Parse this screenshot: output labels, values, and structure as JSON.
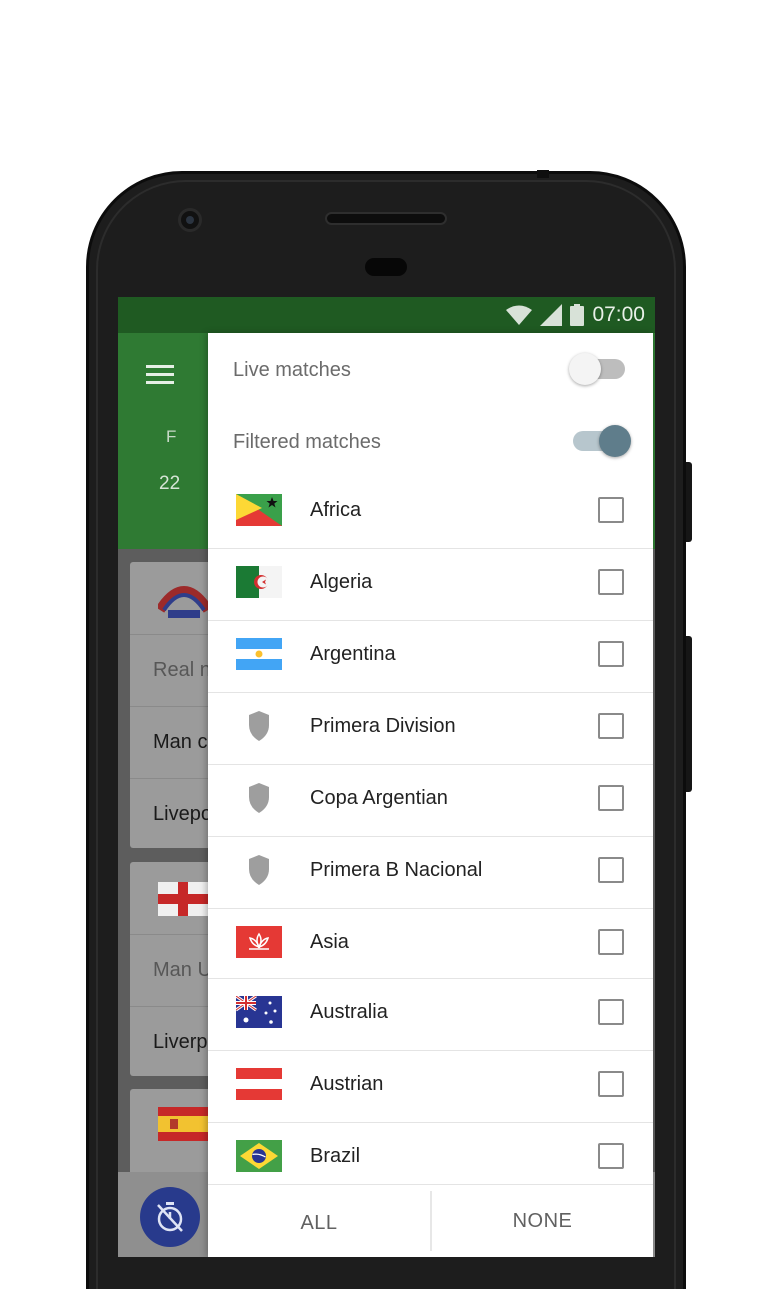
{
  "status_bar": {
    "time": "07:00"
  },
  "appbar": {
    "day_letter": "F",
    "day_number": "22"
  },
  "background_cards": [
    {
      "rows": [
        "Real n",
        "Man c",
        "Livepo"
      ]
    },
    {
      "rows": [
        "Man U",
        "Liverp"
      ]
    }
  ],
  "filter_panel": {
    "live_matches": {
      "label": "Live matches",
      "on": false
    },
    "filtered_matches": {
      "label": "Filtered matches",
      "on": true
    },
    "items": [
      {
        "label": "Africa",
        "icon": "africa-flag-icon",
        "checked": false
      },
      {
        "label": "Algeria",
        "icon": "algeria-flag-icon",
        "checked": false
      },
      {
        "label": "Argentina",
        "icon": "argentina-flag-icon",
        "checked": false
      },
      {
        "label": "Primera Division",
        "icon": "shield-icon",
        "checked": false
      },
      {
        "label": "Copa Argentian",
        "icon": "shield-icon",
        "checked": false
      },
      {
        "label": "Primera B Nacional",
        "icon": "shield-icon",
        "checked": false
      },
      {
        "label": "Asia",
        "icon": "asia-flag-icon",
        "checked": false
      },
      {
        "label": "Australia",
        "icon": "australia-flag-icon",
        "checked": false
      },
      {
        "label": "Austrian",
        "icon": "austria-flag-icon",
        "checked": false
      },
      {
        "label": "Brazil",
        "icon": "brazil-flag-icon",
        "checked": false
      }
    ],
    "actions": {
      "all": "ALL",
      "none": "NONE"
    }
  },
  "colors": {
    "status_bar": "#1f5a22",
    "app_bar": "#2f7a33",
    "switch_on_knob": "#5f7d8b",
    "fab": "#283a8c"
  }
}
